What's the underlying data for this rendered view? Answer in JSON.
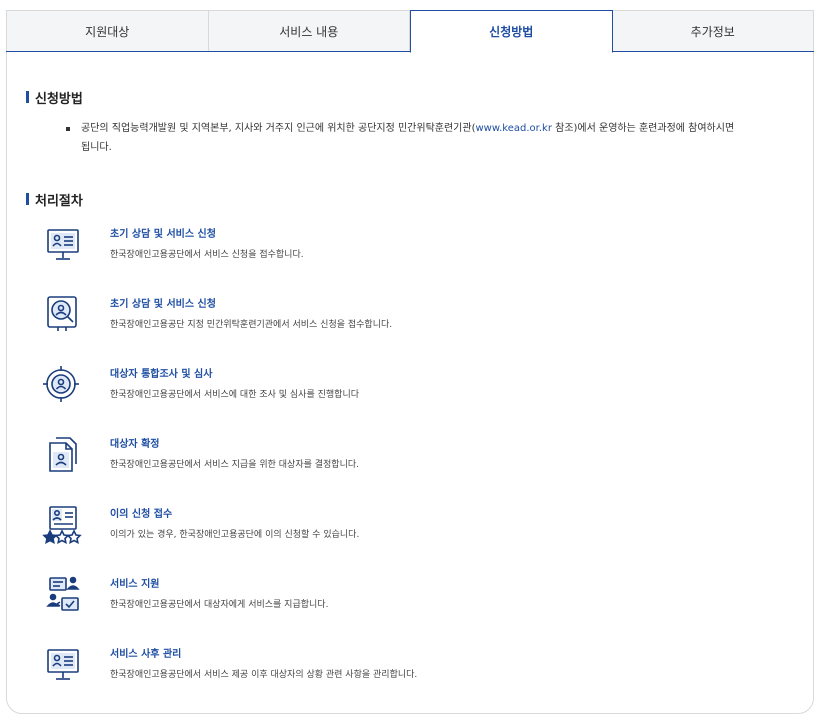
{
  "tabs": [
    {
      "label": "지원대상"
    },
    {
      "label": "서비스 내용"
    },
    {
      "label": "신청방법"
    },
    {
      "label": "추가정보"
    }
  ],
  "application": {
    "title": "신청방법",
    "text_before": "공단의 직업능력개발원 및 지역본부, 지사와 거주지 인근에 위치한 공단지정 민간위탁훈련기관(",
    "link": "www.kead.or.kr",
    "text_after": " 참조)에서 운영하는 훈련과정에 참여하시면 됩니다."
  },
  "process": {
    "title": "처리절차",
    "steps": [
      {
        "icon": "monitor-profile-icon",
        "title": "초기 상담 및 서비스 신청",
        "desc": "한국장애인고용공단에서 서비스 신청을 접수합니다."
      },
      {
        "icon": "magnifier-person-icon",
        "title": "초기 상담 및 서비스 신청",
        "desc": "한국장애인고용공단 지정 민간위탁훈련기관에서 서비스 신청을 접수합니다."
      },
      {
        "icon": "target-person-icon",
        "title": "대상자 통합조사 및 심사",
        "desc": "한국장애인고용공단에서 서비스에 대한 조사 및 심사를 진행합니다"
      },
      {
        "icon": "document-person-icon",
        "title": "대상자 확정",
        "desc": "한국장애인고용공단에서 서비스 지급을 위한 대상자를 결정합니다."
      },
      {
        "icon": "profile-stars-icon",
        "title": "이의 신청 접수",
        "desc": "이의가 있는 경우, 한국장애인고용공단에 이의 신청할 수 있습니다."
      },
      {
        "icon": "people-exchange-icon",
        "title": "서비스 지원",
        "desc": "한국장애인고용공단에서 대상자에게 서비스를 지급합니다."
      },
      {
        "icon": "monitor-profile-icon",
        "title": "서비스 사후 관리",
        "desc": "한국장애인고용공단에서 서비스 제공 이후 대상자의 상황 관련 사항을 관리합니다."
      }
    ]
  },
  "colors": {
    "accent": "#1f4ea3",
    "icon": "#1a3d7c"
  }
}
